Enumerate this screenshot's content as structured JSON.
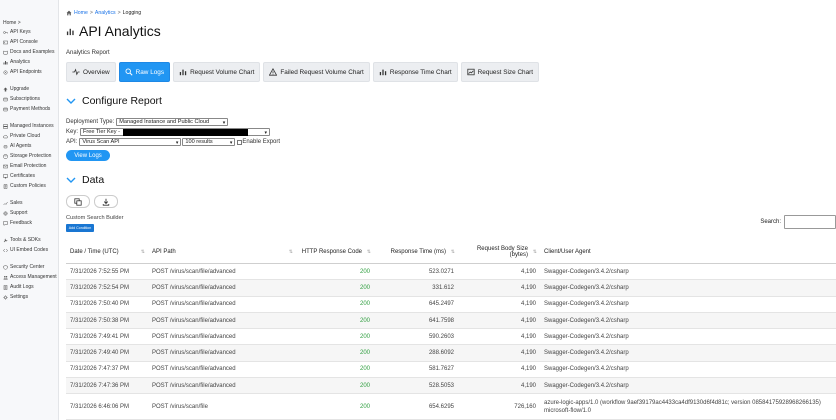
{
  "sidebar": {
    "home": "Home >",
    "groups": [
      [
        {
          "label": "API Keys",
          "icon": "key-icon"
        },
        {
          "label": "API Console",
          "icon": "console-icon"
        },
        {
          "label": "Docs and Examples",
          "icon": "book-icon"
        },
        {
          "label": "Analytics",
          "icon": "chart-icon"
        },
        {
          "label": "API Endpoints",
          "icon": "endpoint-icon"
        }
      ],
      [
        {
          "label": "Upgrade",
          "icon": "upgrade-icon"
        },
        {
          "label": "Subscriptions",
          "icon": "subscription-icon"
        },
        {
          "label": "Payment Methods",
          "icon": "card-icon"
        }
      ],
      [
        {
          "label": "Managed Instances",
          "icon": "server-icon"
        },
        {
          "label": "Private Cloud",
          "icon": "cloud-icon"
        },
        {
          "label": "AI Agents",
          "icon": "robot-icon"
        },
        {
          "label": "Storage Protection",
          "icon": "storage-icon"
        },
        {
          "label": "Email Protection",
          "icon": "mail-icon"
        },
        {
          "label": "Certificates",
          "icon": "certificate-icon"
        },
        {
          "label": "Custom Policies",
          "icon": "policy-icon"
        }
      ],
      [
        {
          "label": "Sales",
          "icon": "sales-icon"
        },
        {
          "label": "Support",
          "icon": "support-icon"
        },
        {
          "label": "Feedback",
          "icon": "feedback-icon"
        }
      ],
      [
        {
          "label": "Tools & SDKs",
          "icon": "tools-icon"
        },
        {
          "label": "UI Embed Codes",
          "icon": "code-icon"
        }
      ],
      [
        {
          "label": "Security Center",
          "icon": "shield-icon"
        },
        {
          "label": "Access Management",
          "icon": "people-icon"
        },
        {
          "label": "Audit Logs",
          "icon": "log-icon"
        },
        {
          "label": "Settings",
          "icon": "gear-icon"
        }
      ]
    ]
  },
  "breadcrumb": {
    "home": "Home",
    "sep": ">",
    "analytics": "Analytics",
    "current": "Logging"
  },
  "page_title": "API Analytics",
  "report_label": "Analytics Report",
  "tabs": [
    {
      "label": "Overview",
      "icon": "pulse-icon",
      "active": false
    },
    {
      "label": "Raw Logs",
      "icon": "search-icon",
      "active": true
    },
    {
      "label": "Request Volume Chart",
      "icon": "bar-chart-icon",
      "active": false
    },
    {
      "label": "Failed Request Volume Chart",
      "icon": "warning-icon",
      "active": false
    },
    {
      "label": "Response Time Chart",
      "icon": "bar-chart-icon",
      "active": false
    },
    {
      "label": "Request Size Chart",
      "icon": "image-chart-icon",
      "active": false
    }
  ],
  "configure": {
    "title": "Configure Report",
    "deployment_label": "Deployment Type:",
    "deployment_value": "Managed Instance and Public Cloud",
    "key_label": "Key:",
    "key_value": "Free Tier Key -",
    "api_label": "API:",
    "api_value": "Virus Scan API",
    "results_value": "100 results",
    "export_label": "Enable Export",
    "view_logs": "View Logs"
  },
  "data_section": {
    "title": "Data",
    "custom_search_label": "Custom Search Builder",
    "add_condition": "Add Condition",
    "search_label": "Search:"
  },
  "table": {
    "headers": [
      "Date / Time (UTC)",
      "API Path",
      "HTTP Response Code",
      "Response Time (ms)",
      "Request Body Size (bytes)",
      "Client/User Agent"
    ],
    "rows": [
      [
        "7/31/2026 7:52:55 PM",
        "POST /virus/scan/file/advanced",
        "200",
        "523.0271",
        "4,190",
        "Swagger-Codegen/3.4.2/csharp"
      ],
      [
        "7/31/2026 7:52:54 PM",
        "POST /virus/scan/file/advanced",
        "200",
        "331.612",
        "4,190",
        "Swagger-Codegen/3.4.2/csharp"
      ],
      [
        "7/31/2026 7:50:40 PM",
        "POST /virus/scan/file/advanced",
        "200",
        "645.2497",
        "4,190",
        "Swagger-Codegen/3.4.2/csharp"
      ],
      [
        "7/31/2026 7:50:38 PM",
        "POST /virus/scan/file/advanced",
        "200",
        "641.7598",
        "4,190",
        "Swagger-Codegen/3.4.2/csharp"
      ],
      [
        "7/31/2026 7:49:41 PM",
        "POST /virus/scan/file/advanced",
        "200",
        "590.2603",
        "4,190",
        "Swagger-Codegen/3.4.2/csharp"
      ],
      [
        "7/31/2026 7:49:40 PM",
        "POST /virus/scan/file/advanced",
        "200",
        "288.6092",
        "4,190",
        "Swagger-Codegen/3.4.2/csharp"
      ],
      [
        "7/31/2026 7:47:37 PM",
        "POST /virus/scan/file/advanced",
        "200",
        "581.7627",
        "4,190",
        "Swagger-Codegen/3.4.2/csharp"
      ],
      [
        "7/31/2026 7:47:36 PM",
        "POST /virus/scan/file/advanced",
        "200",
        "528.5053",
        "4,190",
        "Swagger-Codegen/3.4.2/csharp"
      ],
      [
        "7/31/2026 6:46:06 PM",
        "POST /virus/scan/file",
        "200",
        "654.6295",
        "726,160",
        "azure-logic-apps/1.0 (workflow 9aef39179ac4433ca4df9130d6f4d81c; version 08584175928968266135) microsoft-flow/1.0"
      ]
    ]
  },
  "colors": {
    "accent": "#2196f3",
    "success": "#2e9e3e",
    "link": "#1a73e8"
  }
}
